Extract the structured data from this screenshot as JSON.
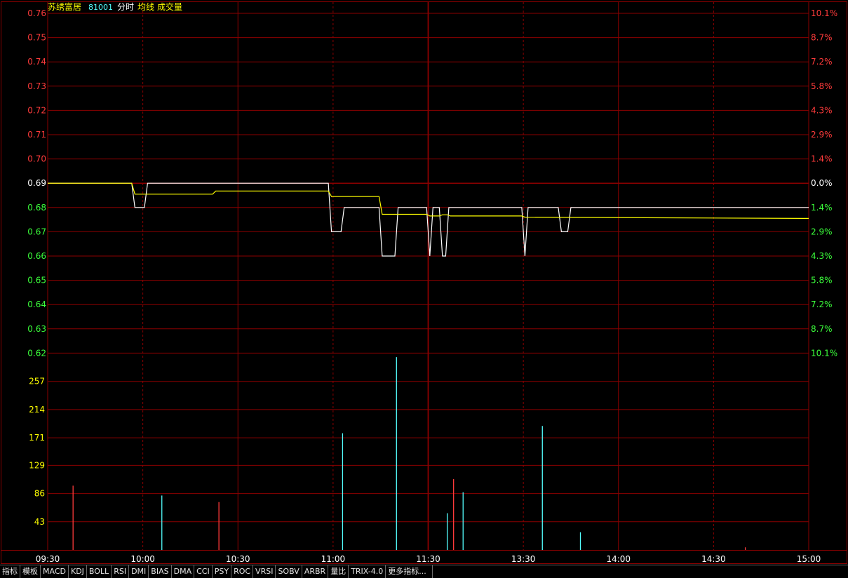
{
  "header": {
    "name": "苏绣富居",
    "code": "81001",
    "mode": "分时",
    "avg_label": "均线",
    "vol_label": "成交量"
  },
  "chart_data": [
    {
      "type": "line",
      "panel": "price",
      "ylim": [
        0.62,
        0.76
      ],
      "prev_close": 0.69,
      "price_ticks": [
        "0.76",
        "0.75",
        "0.74",
        "0.73",
        "0.72",
        "0.71",
        "0.70",
        "0.69",
        "0.68",
        "0.67",
        "0.66",
        "0.65",
        "0.64",
        "0.63",
        "0.62"
      ],
      "pct_ticks": [
        "10.1%",
        "8.7%",
        "7.2%",
        "5.8%",
        "4.3%",
        "2.9%",
        "1.4%",
        "0.0%",
        "1.4%",
        "2.9%",
        "4.3%",
        "5.8%",
        "7.2%",
        "8.7%",
        "10.1%"
      ],
      "x_ticks": [
        "09:30",
        "10:00",
        "10:30",
        "11:00",
        "11:30",
        "13:30",
        "14:00",
        "14:30",
        "15:00"
      ],
      "series": [
        {
          "role": "price",
          "color": "#ffffff",
          "points": [
            [
              0,
              0.69
            ],
            [
              26.5,
              0.69
            ],
            [
              27.5,
              0.68
            ],
            [
              30.5,
              0.68
            ],
            [
              31.5,
              0.69
            ],
            [
              88.5,
              0.69
            ],
            [
              89.5,
              0.67
            ],
            [
              92.5,
              0.67
            ],
            [
              93.5,
              0.68
            ],
            [
              104.5,
              0.68
            ],
            [
              105.5,
              0.66
            ],
            [
              109.5,
              0.66
            ],
            [
              110.5,
              0.68
            ],
            [
              119.5,
              0.68
            ],
            [
              120.5,
              0.66
            ],
            [
              121.5,
              0.68
            ],
            [
              122.5,
              0.68
            ],
            [
              123.5,
              0.68
            ],
            [
              124.5,
              0.66
            ],
            [
              125.5,
              0.66
            ],
            [
              126.5,
              0.68
            ],
            [
              149.5,
              0.68
            ],
            [
              150.5,
              0.66
            ],
            [
              151.5,
              0.68
            ],
            [
              161,
              0.68
            ],
            [
              162,
              0.67
            ],
            [
              164,
              0.67
            ],
            [
              165,
              0.68
            ],
            [
              240,
              0.68
            ]
          ]
        },
        {
          "role": "average",
          "color": "#ffff00",
          "points": [
            [
              0,
              0.69
            ],
            [
              26.5,
              0.69
            ],
            [
              27.5,
              0.6855
            ],
            [
              52,
              0.6855
            ],
            [
              53,
              0.6868
            ],
            [
              88.5,
              0.6868
            ],
            [
              89.5,
              0.6845
            ],
            [
              92,
              0.6845
            ],
            [
              93,
              0.6845
            ],
            [
              104.5,
              0.6845
            ],
            [
              105.5,
              0.6772
            ],
            [
              119.5,
              0.6772
            ],
            [
              120.5,
              0.6765
            ],
            [
              123.5,
              0.6765
            ],
            [
              124.5,
              0.677
            ],
            [
              126,
              0.677
            ],
            [
              127,
              0.6765
            ],
            [
              149.5,
              0.6765
            ],
            [
              150.5,
              0.676
            ],
            [
              240,
              0.6755
            ]
          ]
        }
      ]
    },
    {
      "type": "bar",
      "panel": "volume",
      "ylim": [
        0,
        265
      ],
      "vol_ticks": [
        "257",
        "214",
        "171",
        "129",
        "86",
        "43"
      ],
      "bars": [
        {
          "t": 8,
          "v": 98,
          "color": "#ff3b3b"
        },
        {
          "t": 36,
          "v": 83,
          "color": "#54ffff"
        },
        {
          "t": 54,
          "v": 73,
          "color": "#ff3b3b"
        },
        {
          "t": 93,
          "v": 178,
          "color": "#54ffff"
        },
        {
          "t": 110,
          "v": 294,
          "color": "#54ffff"
        },
        {
          "t": 126,
          "v": 56,
          "color": "#54ffff"
        },
        {
          "t": 128,
          "v": 108,
          "color": "#ff3b3b"
        },
        {
          "t": 131,
          "v": 88,
          "color": "#54ffff"
        },
        {
          "t": 156,
          "v": 189,
          "color": "#54ffff"
        },
        {
          "t": 168,
          "v": 27,
          "color": "#54ffff"
        },
        {
          "t": 220,
          "v": 4,
          "color": "#ff3b3b"
        }
      ]
    }
  ],
  "tabs": [
    "指标",
    "模板",
    "MACD",
    "KDJ",
    "BOLL",
    "RSI",
    "DMI",
    "BIAS",
    "DMA",
    "CCI",
    "PSY",
    "ROC",
    "VRSI",
    "SOBV",
    "ARBR",
    "量比",
    "TRIX-4.0",
    "更多指标..."
  ],
  "colors": {
    "grid": "#8b0000",
    "up": "#ff3b3b",
    "down": "#3bff3b",
    "flat": "#ffffff",
    "vol_axis": "#ffff00",
    "title_name": "#ffff00",
    "title_code": "#54ffff"
  }
}
